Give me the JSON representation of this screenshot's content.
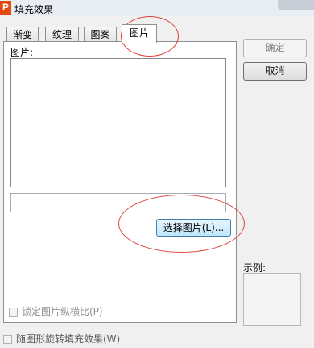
{
  "window": {
    "title": "填充效果",
    "app_icon_letter": "P"
  },
  "tabs": [
    {
      "label": "渐变"
    },
    {
      "label": "纹理"
    },
    {
      "label": "图案"
    },
    {
      "label": "图片",
      "active": true
    }
  ],
  "picture_panel": {
    "label": "图片:",
    "path_value": "",
    "select_button": "选择图片(L)...",
    "lock_aspect_label": "锁定图片纵横比(P)",
    "lock_aspect_checked": false
  },
  "buttons": {
    "ok": "确定",
    "cancel": "取消"
  },
  "sample": {
    "label": "示例:"
  },
  "rotate_with_shape": {
    "label": "随图形旋转填充效果(W)",
    "checked": false
  },
  "annotation_color": "#e0413b"
}
